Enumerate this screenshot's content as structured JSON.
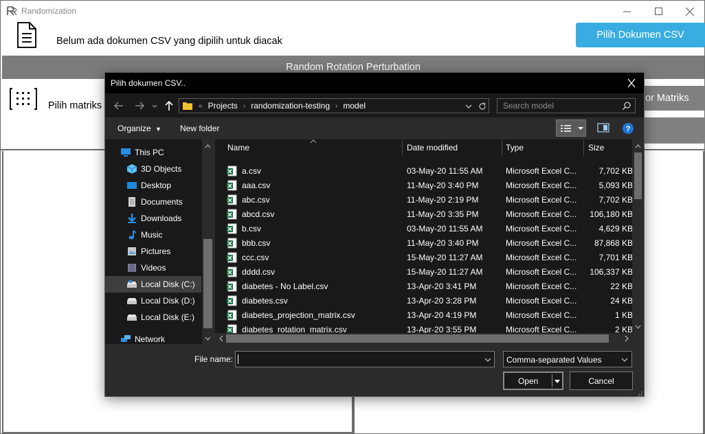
{
  "app": {
    "title": "Randomization",
    "no_document_text": "Belum ada dokumen CSV yang dipilih untuk diacak",
    "pick_document_button": "Pilih Dokumen CSV",
    "section_title": "Random Rotation Perturbation",
    "pick_matrix_text": "Pilih matriks",
    "matrix_button": "or Matriks",
    "accent_color": "#39ade1"
  },
  "dialog": {
    "title": "Pilih dokumen CSV..",
    "breadcrumb": [
      "Projects",
      "randomization-testing",
      "model"
    ],
    "breadcrumb_prefix": "«",
    "search_placeholder": "Search model",
    "organize_label": "Organize",
    "new_folder_label": "New folder",
    "nav_items": [
      {
        "label": "This PC",
        "icon": "computer-icon"
      },
      {
        "label": "3D Objects",
        "icon": "cube-icon"
      },
      {
        "label": "Desktop",
        "icon": "desktop-icon"
      },
      {
        "label": "Documents",
        "icon": "documents-icon"
      },
      {
        "label": "Downloads",
        "icon": "download-icon"
      },
      {
        "label": "Music",
        "icon": "music-icon"
      },
      {
        "label": "Pictures",
        "icon": "pictures-icon"
      },
      {
        "label": "Videos",
        "icon": "videos-icon"
      },
      {
        "label": "Local Disk (C:)",
        "icon": "drive-icon"
      },
      {
        "label": "Local Disk (D:)",
        "icon": "drive-icon"
      },
      {
        "label": "Local Disk (E:)",
        "icon": "drive-icon"
      },
      {
        "label": "Network",
        "icon": "network-icon"
      }
    ],
    "columns": {
      "name": "Name",
      "date": "Date modified",
      "type": "Type",
      "size": "Size"
    },
    "files": [
      {
        "name": "a.csv",
        "date": "03-May-20 11:55 AM",
        "type": "Microsoft Excel C...",
        "size": "7,702 KB"
      },
      {
        "name": "aaa.csv",
        "date": "11-May-20 3:40 PM",
        "type": "Microsoft Excel C...",
        "size": "5,093 KB"
      },
      {
        "name": "abc.csv",
        "date": "11-May-20 2:19 PM",
        "type": "Microsoft Excel C...",
        "size": "7,702 KB"
      },
      {
        "name": "abcd.csv",
        "date": "11-May-20 3:35 PM",
        "type": "Microsoft Excel C...",
        "size": "106,180 KB"
      },
      {
        "name": "b.csv",
        "date": "03-May-20 11:55 AM",
        "type": "Microsoft Excel C...",
        "size": "4,629 KB"
      },
      {
        "name": "bbb.csv",
        "date": "11-May-20 3:40 PM",
        "type": "Microsoft Excel C...",
        "size": "87,868 KB"
      },
      {
        "name": "ccc.csv",
        "date": "15-May-20 11:27 AM",
        "type": "Microsoft Excel C...",
        "size": "7,701 KB"
      },
      {
        "name": "dddd.csv",
        "date": "15-May-20 11:27 AM",
        "type": "Microsoft Excel C...",
        "size": "106,337 KB"
      },
      {
        "name": "diabetes - No Label.csv",
        "date": "13-Apr-20 3:41 PM",
        "type": "Microsoft Excel C...",
        "size": "22 KB"
      },
      {
        "name": "diabetes.csv",
        "date": "13-Apr-20 3:28 PM",
        "type": "Microsoft Excel C...",
        "size": "24 KB"
      },
      {
        "name": "diabetes_projection_matrix.csv",
        "date": "13-Apr-20 4:19 PM",
        "type": "Microsoft Excel C...",
        "size": "1 KB"
      },
      {
        "name": "diabetes_rotation_matrix.csv",
        "date": "13-Apr-20 3:55 PM",
        "type": "Microsoft Excel C...",
        "size": "2 KB"
      }
    ],
    "file_name_label": "File name:",
    "file_name_value": "",
    "file_type_value": "Comma-separated Values",
    "open_label": "Open",
    "cancel_label": "Cancel"
  }
}
